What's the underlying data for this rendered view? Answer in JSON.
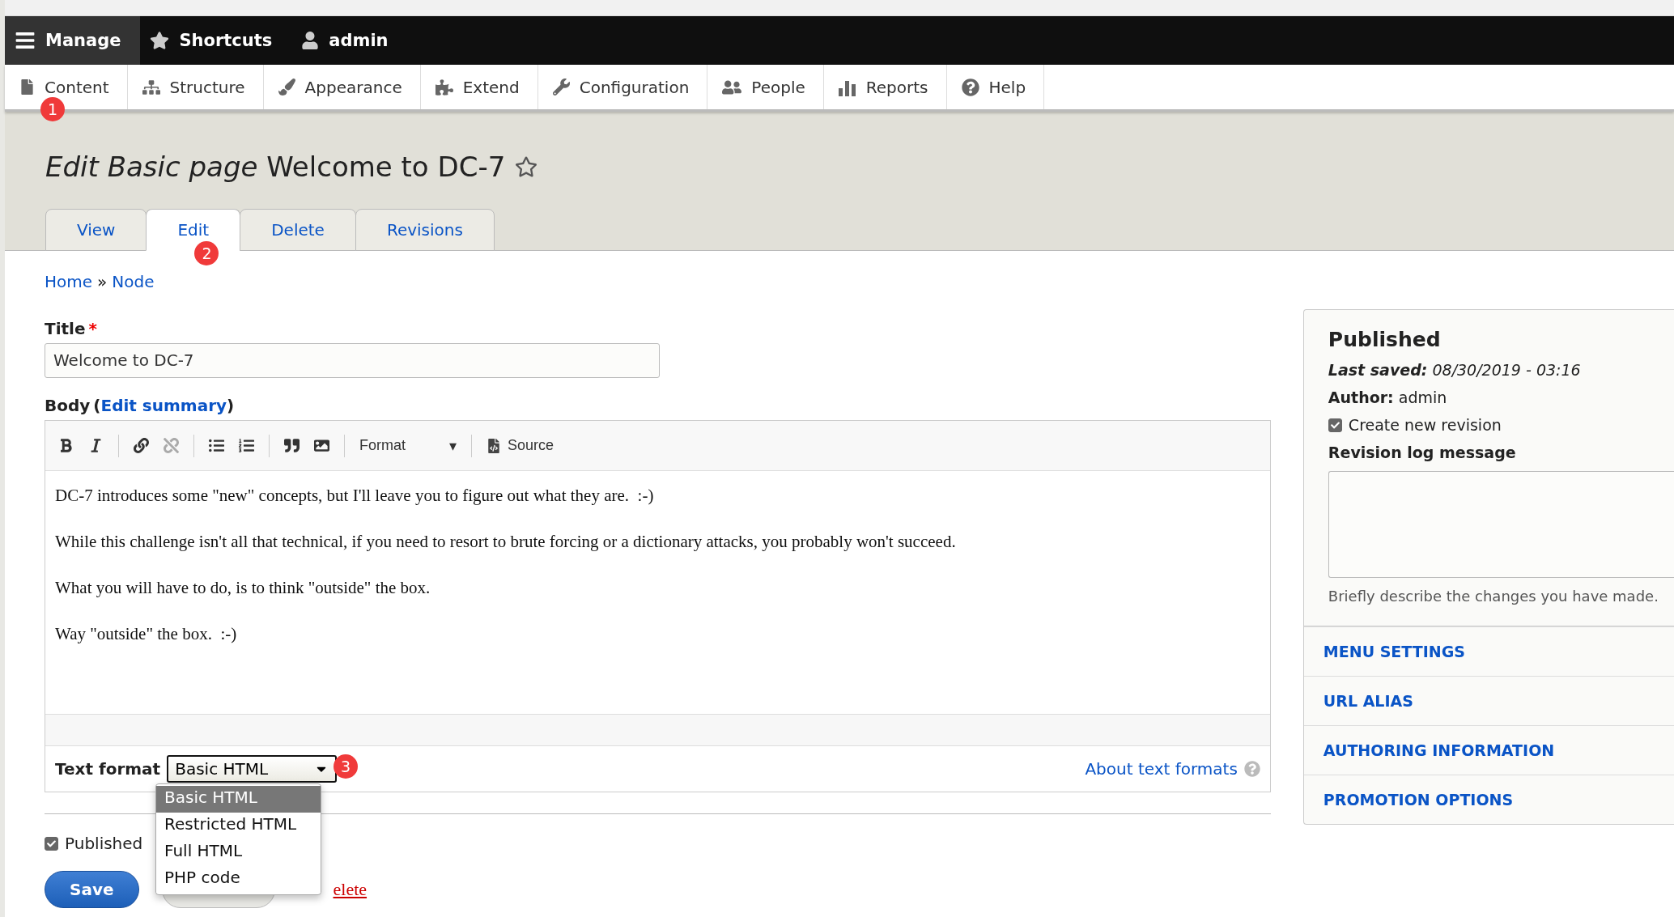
{
  "toolbar": {
    "items": [
      {
        "label": "Manage",
        "selected": true
      },
      {
        "label": "Shortcuts",
        "selected": false
      },
      {
        "label": "admin",
        "selected": false
      }
    ]
  },
  "tray": {
    "items": [
      {
        "label": "Content",
        "badge": "1"
      },
      {
        "label": "Structure"
      },
      {
        "label": "Appearance"
      },
      {
        "label": "Extend"
      },
      {
        "label": "Configuration"
      },
      {
        "label": "People"
      },
      {
        "label": "Reports"
      },
      {
        "label": "Help"
      }
    ]
  },
  "header": {
    "title_prefix": "Edit Basic page",
    "title": "Welcome to DC-7"
  },
  "tabs": [
    {
      "label": "View",
      "selected": false
    },
    {
      "label": "Edit",
      "selected": true,
      "badge": "2"
    },
    {
      "label": "Delete",
      "selected": false
    },
    {
      "label": "Revisions",
      "selected": false
    }
  ],
  "breadcrumb": {
    "items": [
      "Home",
      "Node"
    ],
    "separator": "»"
  },
  "title_field": {
    "label": "Title",
    "required_mark": "*",
    "value": "Welcome to DC-7"
  },
  "body": {
    "label": "Body",
    "open_paren": "(",
    "link": "Edit summary",
    "close_paren": ")",
    "editor_buttons": [
      {
        "disabled": false
      },
      {
        "disabled": false
      },
      {
        "disabled": false
      },
      {
        "disabled": true
      },
      {
        "disabled": false
      },
      {
        "disabled": false
      },
      {
        "disabled": false
      },
      {
        "disabled": false
      }
    ],
    "format_label": "Format",
    "format_caret": "▾",
    "source_label": "Source",
    "paragraphs": [
      "DC-7 introduces some \"new\" concepts, but I'll leave you to figure out what they are.  :-)",
      "While this challenge isn't all that technical, if you need to resort to brute forcing or a dictionary attacks, you probably won't succeed.",
      "What you will have to do, is to think \"outside\" the box.",
      "Way \"outside\" the box.  :-)"
    ]
  },
  "text_format": {
    "label": "Text format",
    "value": "Basic HTML",
    "expanded": true,
    "badge": "3",
    "about_link": "About text formats",
    "options": [
      {
        "label": "Basic HTML",
        "selected": true
      },
      {
        "label": "Restricted HTML",
        "selected": false
      },
      {
        "label": "Full HTML",
        "selected": false
      },
      {
        "label": "PHP code",
        "selected": false
      }
    ]
  },
  "published": {
    "label": "Published",
    "checked": true
  },
  "actions": [
    {
      "label": "Save",
      "kind": "primary"
    },
    {
      "kind": "secondary"
    },
    {
      "label": "elete",
      "kind": "link"
    }
  ],
  "sidebar": {
    "status": "Published",
    "last_saved_label": "Last saved:",
    "last_saved": "08/30/2019 - 03:16",
    "author_label": "Author:",
    "author": "admin",
    "revision": {
      "label": "Create new revision",
      "checked": true
    },
    "log_label": "Revision log message",
    "log_description": "Briefly describe the changes you have made.",
    "sections": [
      "MENU SETTINGS",
      "URL ALIAS",
      "AUTHORING INFORMATION",
      "PROMOTION OPTIONS"
    ]
  }
}
